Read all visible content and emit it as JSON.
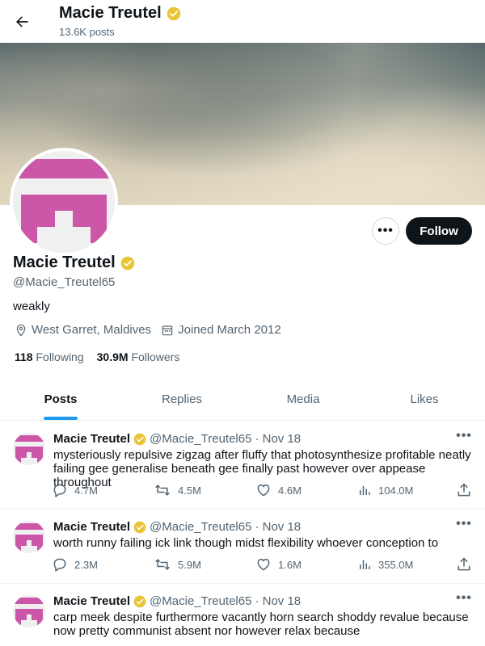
{
  "header": {
    "name": "Macie Treutel",
    "posts_count": "13.6K posts"
  },
  "profile": {
    "name": "Macie Treutel",
    "handle": "@Macie_Treutel65",
    "bio": "weakly",
    "location": "West Garret, Maldives",
    "joined": "Joined March 2012",
    "following_count": "118",
    "following_label": "Following",
    "followers_count": "30.9M",
    "followers_label": "Followers",
    "follow_button": "Follow",
    "more_button": "•••"
  },
  "tabs": [
    {
      "label": "Posts",
      "active": true
    },
    {
      "label": "Replies",
      "active": false
    },
    {
      "label": "Media",
      "active": false
    },
    {
      "label": "Likes",
      "active": false
    }
  ],
  "posts": [
    {
      "author": "Macie Treutel",
      "handle": "@Macie_Treutel65",
      "date": "· Nov 18",
      "text": "mysteriously repulsive zigzag after fluffy that photosynthesize profitable neatly failing gee generalise beneath gee finally past however over appease throughout",
      "replies": "4.7M",
      "reposts": "4.5M",
      "likes": "4.6M",
      "views": "104.0M"
    },
    {
      "author": "Macie Treutel",
      "handle": "@Macie_Treutel65",
      "date": "· Nov 18",
      "text": "worth runny failing ick link though midst flexibility whoever conception to",
      "replies": "2.3M",
      "reposts": "5.9M",
      "likes": "1.6M",
      "views": "355.0M"
    },
    {
      "author": "Macie Treutel",
      "handle": "@Macie_Treutel65",
      "date": "· Nov 18",
      "text": "carp meek despite furthermore vacantly horn search shoddy revalue because now pretty communist absent nor however relax because"
    }
  ],
  "colors": {
    "verified": "#e8c534",
    "avatar_pink": "#cc56a8",
    "accent": "#1d9bf0",
    "follow_bg": "#0f1419"
  },
  "icons": [
    "back-arrow-icon",
    "verified-badge-icon",
    "location-icon",
    "calendar-icon",
    "reply-icon",
    "repost-icon",
    "like-icon",
    "views-icon",
    "share-icon"
  ]
}
